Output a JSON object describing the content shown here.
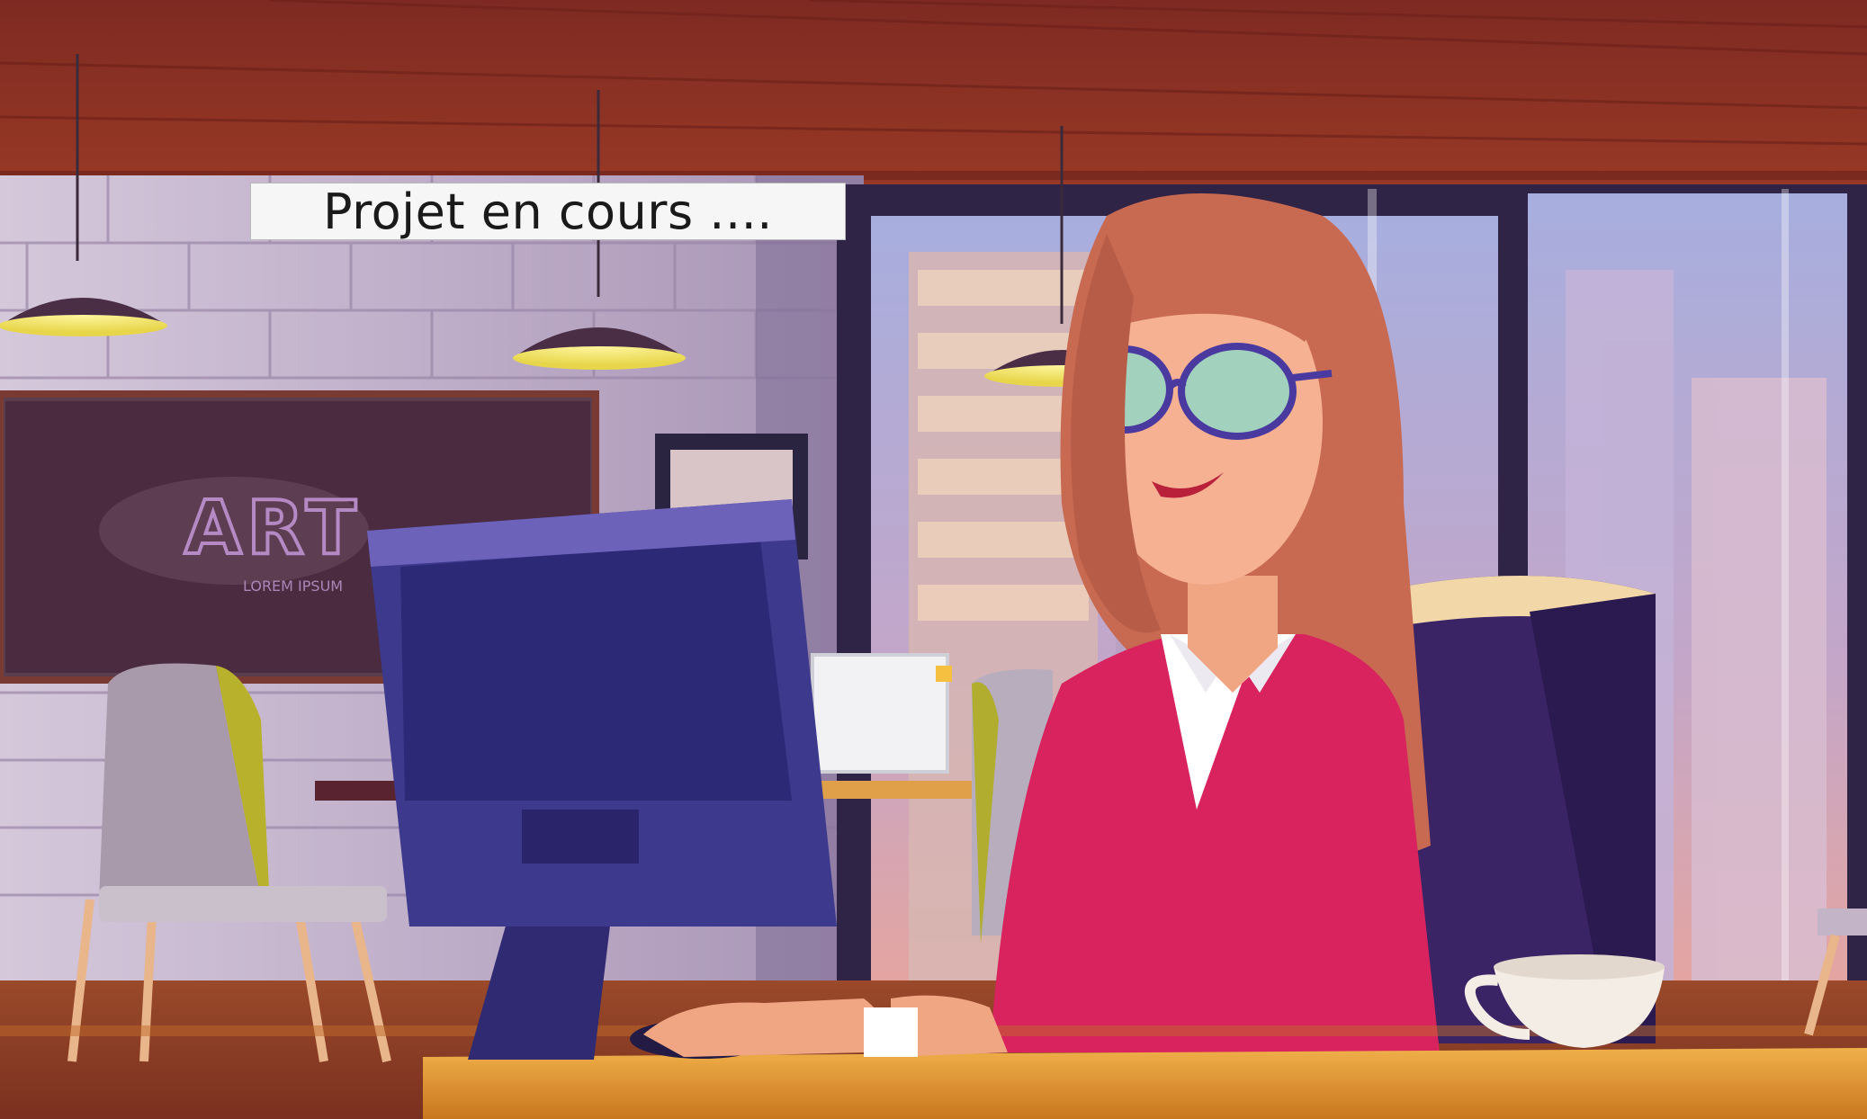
{
  "caption": {
    "text": "Projet en cours ...."
  },
  "illustration": {
    "board_title": "ART",
    "board_subtitle": "LOREM IPSUM",
    "colors": {
      "ceiling": "#8d2f24",
      "wall": "#b8a6c4",
      "window_glass": "#bcc4e6",
      "desk": "#e0962f",
      "monitor": "#3d3a8e",
      "jacket": "#d8235e",
      "hair": "#c86a52",
      "chair": "#3a2466"
    }
  }
}
